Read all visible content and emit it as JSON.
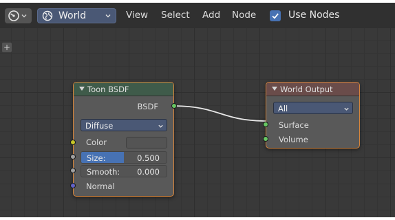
{
  "header": {
    "editor_type_icon": "node-editor-icon",
    "shader_type": "World",
    "shader_type_icon": "world-icon",
    "menus": [
      "View",
      "Select",
      "Add",
      "Node"
    ],
    "use_nodes_label": "Use Nodes",
    "use_nodes_checked": true
  },
  "toolbar": {
    "add_icon": "+"
  },
  "toon_node": {
    "title": "Toon BSDF",
    "output_label": "BSDF",
    "component": "Diffuse",
    "color_label": "Color",
    "size_label": "Size:",
    "size_value": "0.500",
    "size_fraction": 0.5,
    "smooth_label": "Smooth:",
    "smooth_value": "0.000",
    "normal_label": "Normal"
  },
  "output_node": {
    "title": "World Output",
    "target": "All",
    "surface_label": "Surface",
    "volume_label": "Volume"
  },
  "colors": {
    "header_bg": "#303030",
    "grid_bg": "#393939",
    "node_border": "#d6843a",
    "accent_blue": "#4772b3",
    "socket_shader": "#67c663",
    "socket_color": "#c7c729",
    "socket_float": "#a1a1a1",
    "socket_vector": "#6363c7",
    "link": "#e8e8e8"
  }
}
